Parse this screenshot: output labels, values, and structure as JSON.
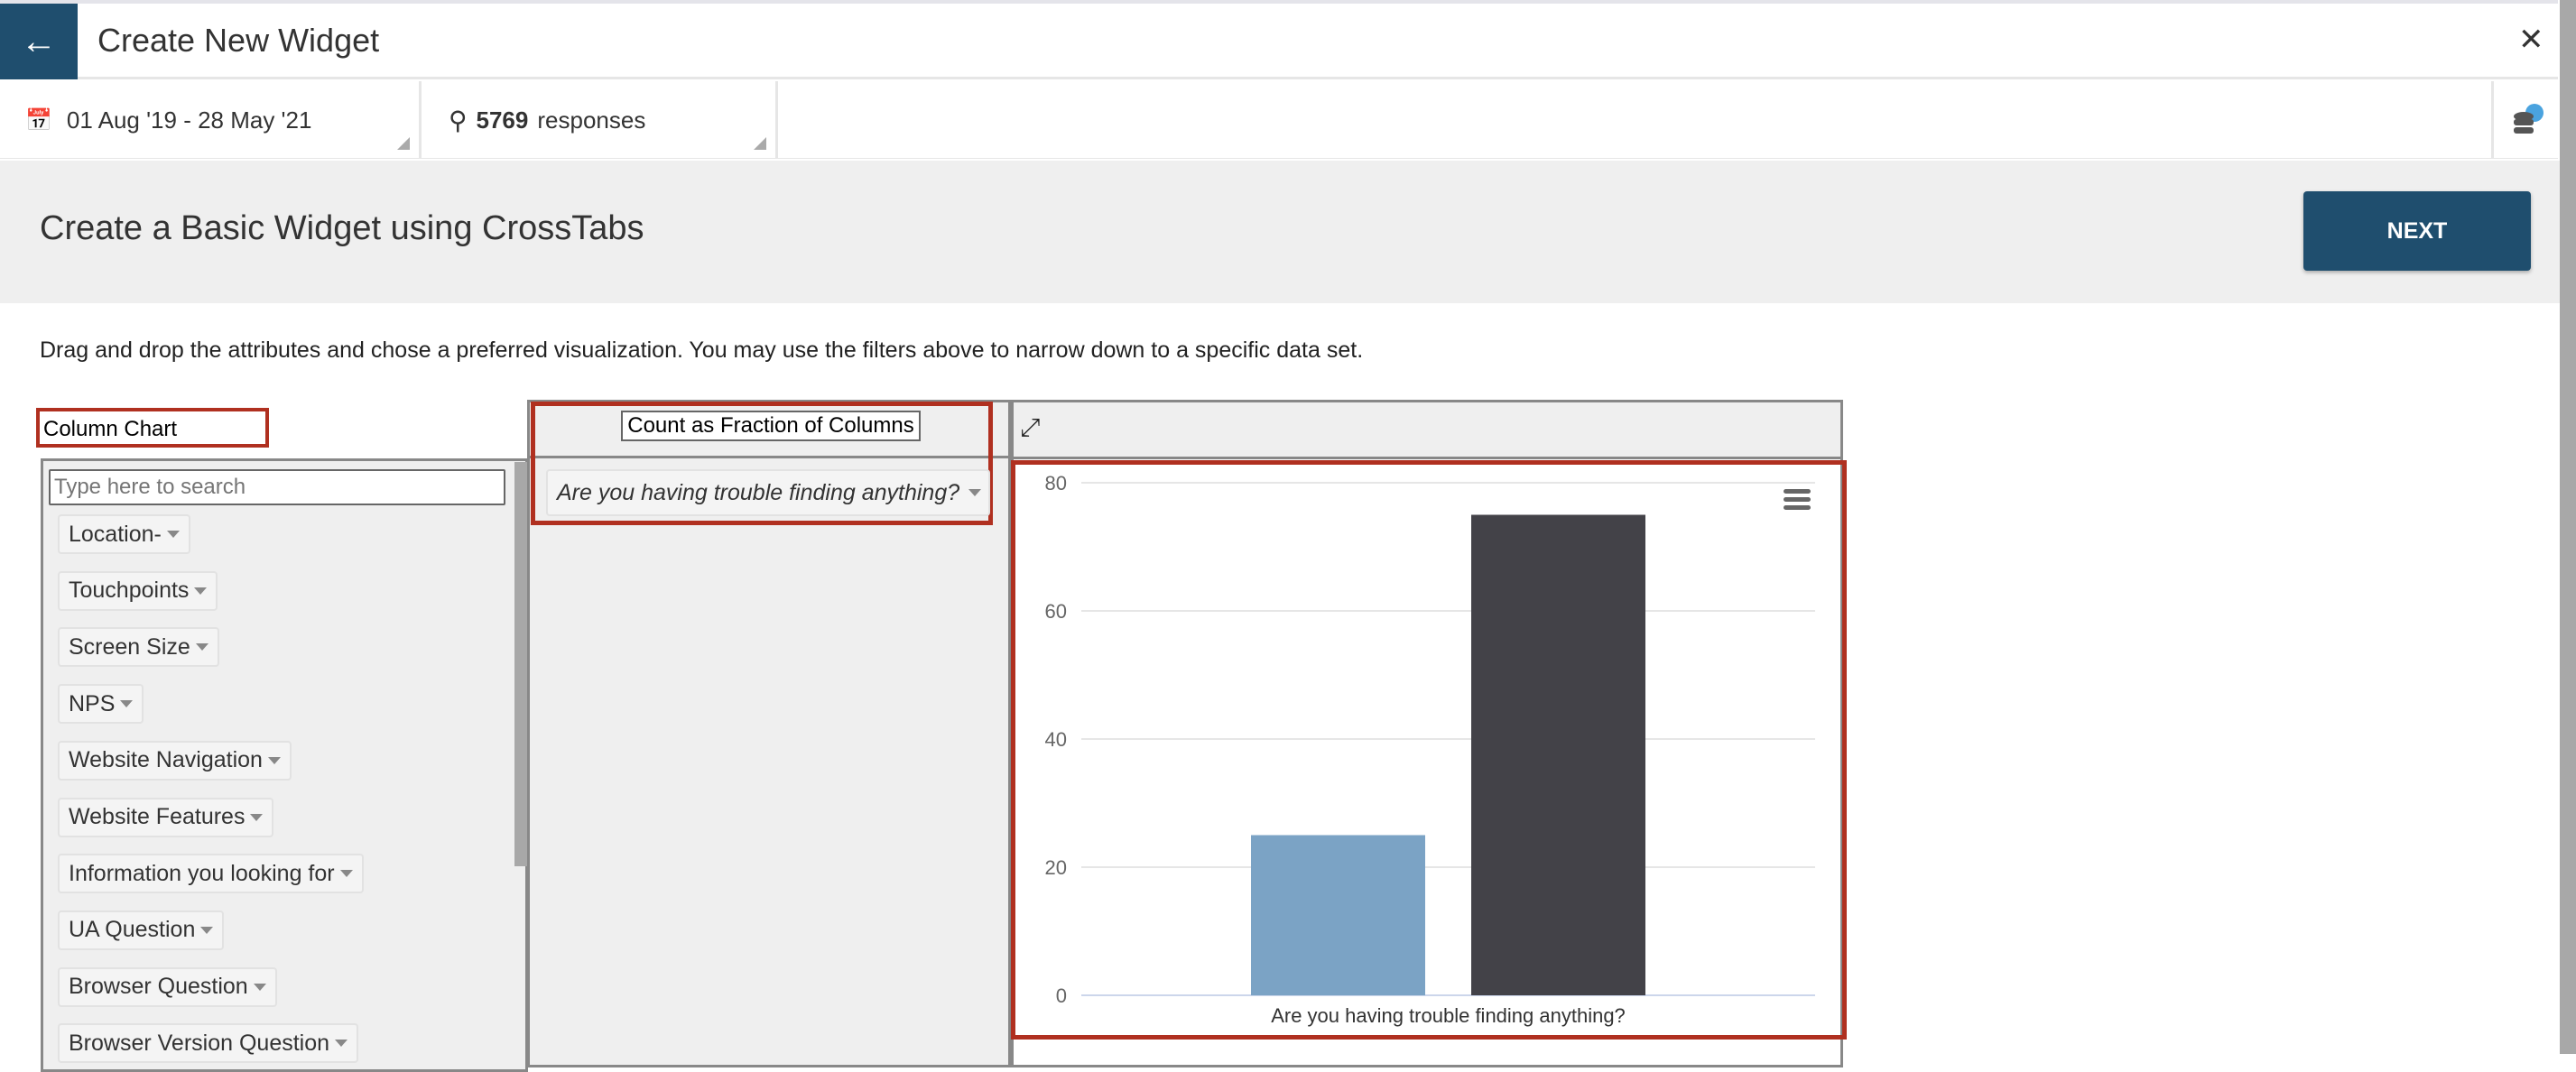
{
  "header": {
    "title": "Create New Widget",
    "back_icon": "arrow-left-icon",
    "close_icon": "close-icon"
  },
  "filters": {
    "date_range": "01 Aug '19 - 28 May '21",
    "responses_count": "5769",
    "responses_label": "responses"
  },
  "band": {
    "title": "Create a Basic Widget using CrossTabs",
    "next_label": "NEXT"
  },
  "instructions": "Drag and drop the attributes and chose a preferred visualization. You may use the filters above to narrow down to a specific data set.",
  "visualization": "Column Chart",
  "search": {
    "placeholder": "Type here to search",
    "value": ""
  },
  "attributes": [
    "Location-",
    "Touchpoints",
    "Screen Size",
    "NPS",
    "Website Navigation",
    "Website Features",
    "Information you looking for",
    "UA Question",
    "Browser Question",
    "Browser Version Question"
  ],
  "aggregation": "Count as Fraction of Columns",
  "column_attribute": "Are you having trouble finding anything?",
  "colors": {
    "accent": "#1f4e6e",
    "highlight": "#b03020"
  },
  "chart_data": {
    "type": "bar",
    "categories": [
      "Are you having trouble finding anything?"
    ],
    "series": [
      {
        "values": [
          25
        ],
        "color": "#7ba3c5"
      },
      {
        "values": [
          75
        ],
        "color": "#434248"
      }
    ],
    "ylim": [
      0,
      80
    ],
    "yticks": [
      0,
      20,
      40,
      60,
      80
    ],
    "grid": true,
    "xlabel": "",
    "ylabel": ""
  }
}
